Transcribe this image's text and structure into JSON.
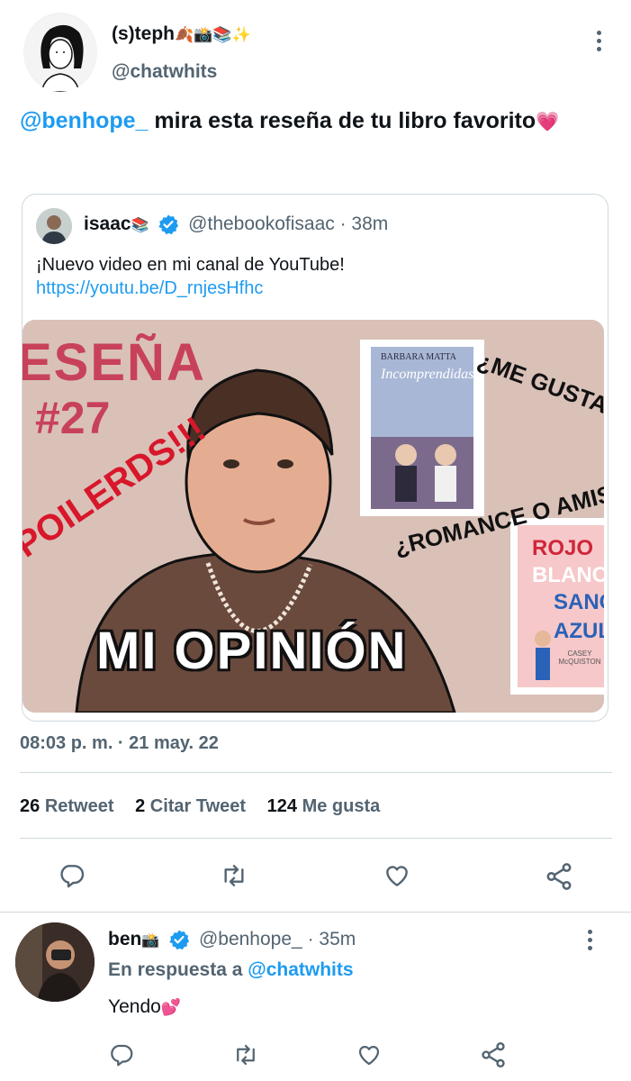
{
  "main_tweet": {
    "display_name": "(s)teph",
    "name_emojis": "🍂📸📚✨",
    "handle": "@chatwhits",
    "mention": "@benhope_",
    "text": " mira esta reseña de tu libro favorito",
    "text_emoji": "💗",
    "timestamp": "08:03 p. m. · 21 may. 22",
    "stats": [
      {
        "count": "26",
        "label": "Retweet"
      },
      {
        "count": "2",
        "label": "Citar Tweet"
      },
      {
        "count": "124",
        "label": "Me gusta"
      }
    ]
  },
  "quoted_tweet": {
    "display_name": "isaac",
    "name_emoji": "📚",
    "handle": "@thebookofisaac",
    "time": "· 38m",
    "text": "¡Nuevo video en mi canal de YouTube!",
    "link": "https://youtu.be/D_rnjesHfhc",
    "thumbnail": {
      "title_line1": "ESEÑA",
      "title_line2": "#27",
      "spoilers": "POILERDS!!!",
      "question1": "¿ME GUSTAR",
      "question2": "¿ROMANCE O AMIST",
      "caption": "MI OPINIÓN",
      "book1": {
        "author": "BARBARA MATTA",
        "title": "Incomprendidas"
      },
      "book2": {
        "line1": "ROJO",
        "line2": "BLANC",
        "line3": "SANG",
        "line4": "AZUL",
        "author": "CASEY McQUISTON"
      }
    }
  },
  "reply": {
    "display_name": "ben",
    "name_emoji": "📸",
    "handle": "@benhope_",
    "time": "· 35m",
    "reply_prefix": "En respuesta a ",
    "reply_to": "@chatwhits",
    "text": "Yendo",
    "text_emoji": "💕"
  },
  "colors": {
    "accent": "#1d9bf0",
    "secondary_text": "#536471",
    "divider": "#cfd9de",
    "thumb_bg": "#d9c1b8",
    "title_pink": "#c8415a"
  }
}
